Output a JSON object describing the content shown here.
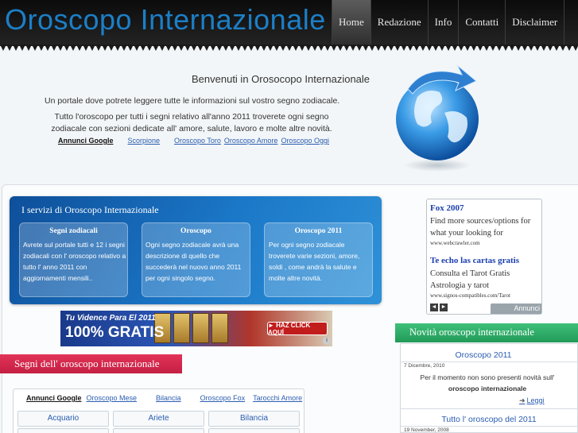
{
  "header": {
    "site_title": "Oroscopo Internazionale",
    "nav": [
      "Home",
      "Redazione",
      "Info",
      "Contatti",
      "Disclaimer"
    ]
  },
  "welcome": {
    "title": "Benvenuti in Orosocopo Internazionale",
    "line1": "Un portale dove potrete leggere tutte le informazioni sul vostro segno zodiacale.",
    "line2": "Tutto l'oroscopo per tutti i segni relativo all'anno 2011 troverete ogni segno zodiacale con sezioni dedicate all' amore, salute, lavoro e molte altre novità.",
    "ads_label": "Annunci Google",
    "ads_links": [
      "Scorpione",
      "Oroscopo Toro",
      "Oroscopo Amore",
      "Oroscopo Oggi"
    ]
  },
  "services": {
    "title": "I servizi di Oroscopo Internazionale",
    "cards": [
      {
        "head": "Segni zodiacali",
        "text": "Avrete sul portale tutti e 12 i segni zodiacali con l' oroscopo relativo a tutto l' anno 2011 con aggiornamenti mensili.."
      },
      {
        "head": "Oroscopo",
        "text": "Ogni segno zodiacale avrà una descrizione di quello che succederà nel nuovo anno 2011 per ogni singolo segno."
      },
      {
        "head": "Oroscopo 2011",
        "text": "Per ogni segno zodiacale troverete varie sezioni, amore, soldi , come andrà la salute e molte altre novità."
      }
    ]
  },
  "banner": {
    "line1": "Tu Vidence Para El 2011",
    "line2": "100% GRATIS",
    "button": "► HAZ CLICK AQUÍ",
    "info_icon": "i"
  },
  "signs": {
    "tab_title": "Segni dell' oroscopo internazionale",
    "ads_label": "Annunci Google",
    "ads_links": [
      "Oroscopo Mese",
      "Bilancia",
      "Oroscopo Fox",
      "Tarocchi Amore"
    ],
    "cells": [
      "Acquario",
      "Ariete",
      "Bilancia"
    ]
  },
  "adbox": {
    "ads": [
      {
        "title": "Fox 2007",
        "body": "Find more sources/options for what your looking for",
        "url": "www.webcrawler.com"
      },
      {
        "title": "Te echo las cartas gratis",
        "body": "Consulta el Tarot Gratis Astrologia y tarot",
        "url": "www.signos-compatibles.com/Tarot"
      }
    ],
    "prev": "◄",
    "next": "►",
    "google_label": "Annunci Google"
  },
  "news": {
    "tab_title": "Novità oroscopo internazionale",
    "items": [
      {
        "head": "Oroscopo 2011",
        "date": "7 Dicembre, 2010",
        "text": "Per il momento non sono presenti novità sull'",
        "strong": "oroscopo internazionale",
        "more": "Leggi"
      },
      {
        "head": "Tutto l' oroscopo del 2011",
        "date": "19 November, 2008"
      }
    ]
  }
}
